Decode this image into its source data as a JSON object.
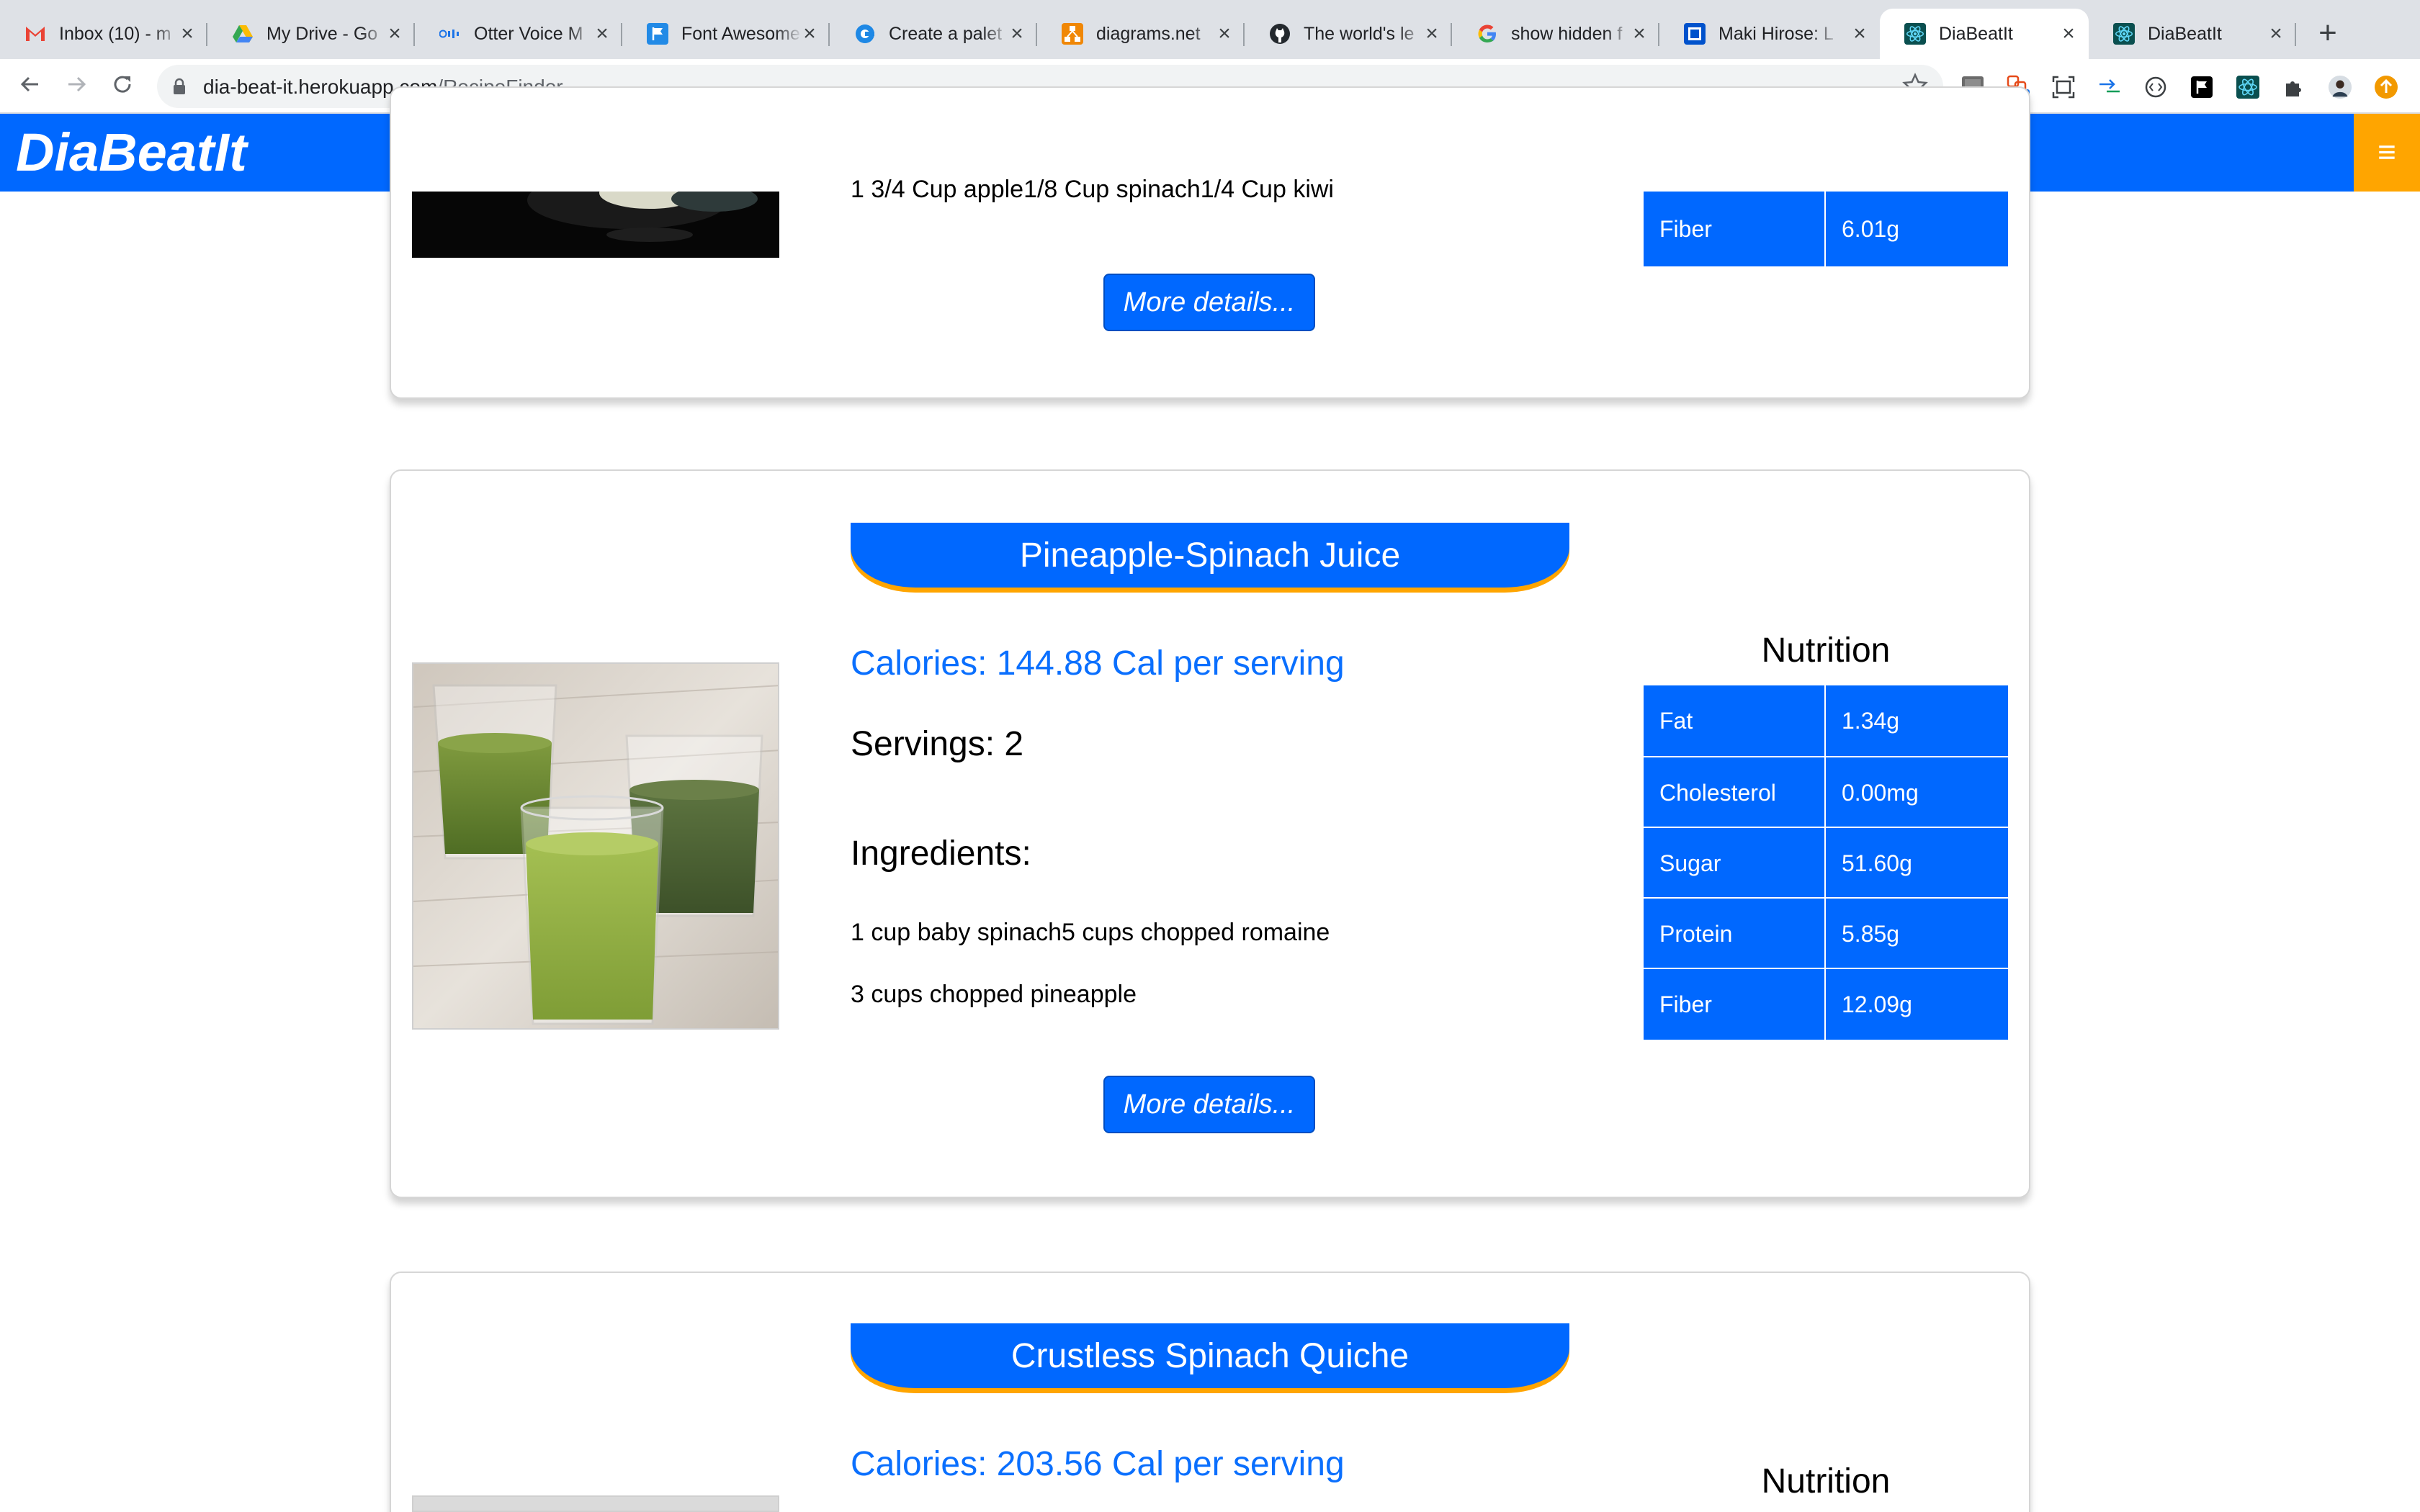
{
  "browser": {
    "tabs": [
      {
        "title": "Inbox (10) - m",
        "icon": "gmail-icon",
        "color": "#ea4335"
      },
      {
        "title": "My Drive - Go",
        "icon": "drive-icon",
        "color": "#34a853"
      },
      {
        "title": "Otter Voice M",
        "icon": "otter-icon",
        "color": "#1a73e8"
      },
      {
        "title": "Font Awesome",
        "icon": "font-awesome-icon",
        "color": "#228ae6"
      },
      {
        "title": "Create a palet",
        "icon": "coolors-icon",
        "color": "#1e88e5"
      },
      {
        "title": "diagrams.net",
        "icon": "diagrams-icon",
        "color": "#f08705"
      },
      {
        "title": "The world's le",
        "icon": "github-icon",
        "color": "#24292e"
      },
      {
        "title": "show hidden f",
        "icon": "google-icon",
        "color": "#4285f4"
      },
      {
        "title": "Maki Hirose: L",
        "icon": "trello-icon",
        "color": "#0052cc"
      },
      {
        "title": "DiaBeatIt",
        "icon": "react-icon",
        "color": "#0a4f4f",
        "active": true
      },
      {
        "title": "DiaBeatIt",
        "icon": "react-icon",
        "color": "#0a4f4f"
      }
    ],
    "close_glyph": "×",
    "new_tab_glyph": "+",
    "url_host": "dia-beat-it.herokuapp.com",
    "url_path": "/RecipeFinder",
    "extension_badge": "1"
  },
  "app": {
    "brand": "DiaBeatIt",
    "menu_glyph": "≡"
  },
  "cards": {
    "prev": {
      "ingredient_partial": "1 3/4 Cup apple1/8 Cup spinach1/4 Cup kiwi",
      "fiber_label": "Fiber",
      "fiber_value": "6.01g",
      "details_label": "More details..."
    },
    "juice": {
      "title": "Pineapple-Spinach Juice",
      "calories": "Calories: 144.88 Cal per serving",
      "servings": "Servings: 2",
      "ingredients_heading": "Ingredients:",
      "ingredients": [
        "1 cup baby spinach5 cups chopped romaine",
        "3 cups chopped pineapple"
      ],
      "nutrition_heading": "Nutrition",
      "nutrition": [
        {
          "label": "Fat",
          "value": "1.34g"
        },
        {
          "label": "Cholesterol",
          "value": "0.00mg"
        },
        {
          "label": "Sugar",
          "value": "51.60g"
        },
        {
          "label": "Protein",
          "value": "5.85g"
        },
        {
          "label": "Fiber",
          "value": "12.09g"
        }
      ],
      "details_label": "More details..."
    },
    "quiche": {
      "title": "Crustless Spinach Quiche",
      "calories": "Calories: 203.56 Cal per serving",
      "nutrition_heading": "Nutrition"
    }
  },
  "colors": {
    "primary": "#0068ff",
    "accent": "#ffa500",
    "calories_text": "#0a6ffe"
  }
}
